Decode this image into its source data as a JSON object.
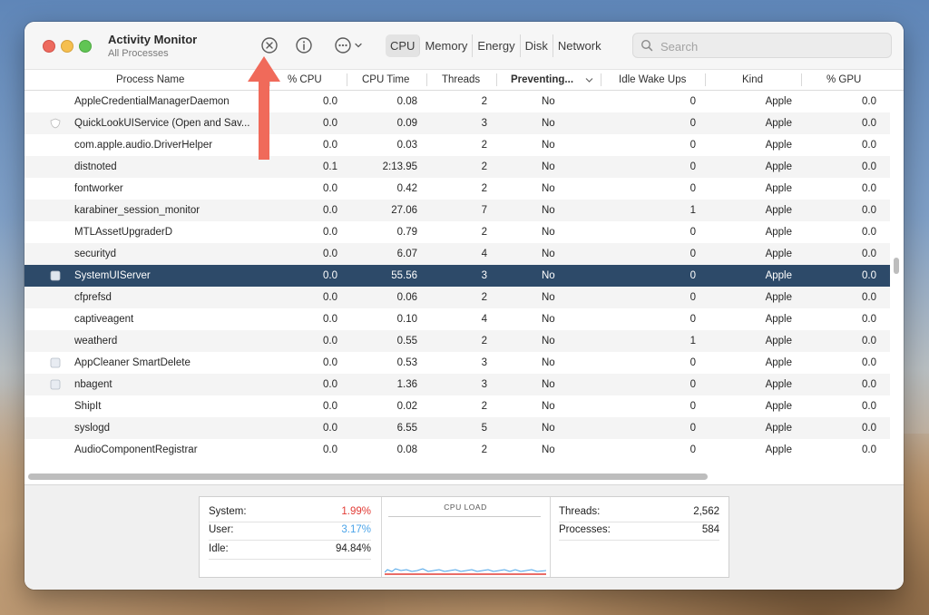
{
  "app": {
    "title": "Activity Monitor",
    "subtitle": "All Processes"
  },
  "toolbar": {
    "stop_icon": "stop-process-icon",
    "info_icon": "info-icon",
    "more_icon": "ellipsis-icon",
    "tabs": [
      "CPU",
      "Memory",
      "Energy",
      "Disk",
      "Network"
    ],
    "active_tab": "CPU",
    "search_placeholder": "Search"
  },
  "columns": [
    "Process Name",
    "% CPU",
    "CPU Time",
    "Threads",
    "Preventing...",
    "Idle Wake Ups",
    "Kind",
    "% GPU"
  ],
  "rows": [
    {
      "icon": "",
      "name": "AppleCredentialManagerDaemon",
      "cpu": "0.0",
      "time": "0.08",
      "threads": "2",
      "preventing": "No",
      "idle": "0",
      "kind": "Apple",
      "gpu": "0.0"
    },
    {
      "icon": "shield",
      "name": "QuickLookUIService (Open and Sav...",
      "cpu": "0.0",
      "time": "0.09",
      "threads": "3",
      "preventing": "No",
      "idle": "0",
      "kind": "Apple",
      "gpu": "0.0"
    },
    {
      "icon": "",
      "name": "com.apple.audio.DriverHelper",
      "cpu": "0.0",
      "time": "0.03",
      "threads": "2",
      "preventing": "No",
      "idle": "0",
      "kind": "Apple",
      "gpu": "0.0"
    },
    {
      "icon": "",
      "name": "distnoted",
      "cpu": "0.1",
      "time": "2:13.95",
      "threads": "2",
      "preventing": "No",
      "idle": "0",
      "kind": "Apple",
      "gpu": "0.0"
    },
    {
      "icon": "",
      "name": "fontworker",
      "cpu": "0.0",
      "time": "0.42",
      "threads": "2",
      "preventing": "No",
      "idle": "0",
      "kind": "Apple",
      "gpu": "0.0"
    },
    {
      "icon": "",
      "name": "karabiner_session_monitor",
      "cpu": "0.0",
      "time": "27.06",
      "threads": "7",
      "preventing": "No",
      "idle": "1",
      "kind": "Apple",
      "gpu": "0.0"
    },
    {
      "icon": "",
      "name": "MTLAssetUpgraderD",
      "cpu": "0.0",
      "time": "0.79",
      "threads": "2",
      "preventing": "No",
      "idle": "0",
      "kind": "Apple",
      "gpu": "0.0"
    },
    {
      "icon": "",
      "name": "securityd",
      "cpu": "0.0",
      "time": "6.07",
      "threads": "4",
      "preventing": "No",
      "idle": "0",
      "kind": "Apple",
      "gpu": "0.0"
    },
    {
      "icon": "app",
      "name": "SystemUIServer",
      "cpu": "0.0",
      "time": "55.56",
      "threads": "3",
      "preventing": "No",
      "idle": "0",
      "kind": "Apple",
      "gpu": "0.0",
      "selected": true
    },
    {
      "icon": "",
      "name": "cfprefsd",
      "cpu": "0.0",
      "time": "0.06",
      "threads": "2",
      "preventing": "No",
      "idle": "0",
      "kind": "Apple",
      "gpu": "0.0"
    },
    {
      "icon": "",
      "name": "captiveagent",
      "cpu": "0.0",
      "time": "0.10",
      "threads": "4",
      "preventing": "No",
      "idle": "0",
      "kind": "Apple",
      "gpu": "0.0"
    },
    {
      "icon": "",
      "name": "weatherd",
      "cpu": "0.0",
      "time": "0.55",
      "threads": "2",
      "preventing": "No",
      "idle": "1",
      "kind": "Apple",
      "gpu": "0.0"
    },
    {
      "icon": "app",
      "name": "AppCleaner SmartDelete",
      "cpu": "0.0",
      "time": "0.53",
      "threads": "3",
      "preventing": "No",
      "idle": "0",
      "kind": "Apple",
      "gpu": "0.0"
    },
    {
      "icon": "app",
      "name": "nbagent",
      "cpu": "0.0",
      "time": "1.36",
      "threads": "3",
      "preventing": "No",
      "idle": "0",
      "kind": "Apple",
      "gpu": "0.0"
    },
    {
      "icon": "",
      "name": "ShipIt",
      "cpu": "0.0",
      "time": "0.02",
      "threads": "2",
      "preventing": "No",
      "idle": "0",
      "kind": "Apple",
      "gpu": "0.0"
    },
    {
      "icon": "",
      "name": "syslogd",
      "cpu": "0.0",
      "time": "6.55",
      "threads": "5",
      "preventing": "No",
      "idle": "0",
      "kind": "Apple",
      "gpu": "0.0"
    },
    {
      "icon": "",
      "name": "AudioComponentRegistrar",
      "cpu": "0.0",
      "time": "0.08",
      "threads": "2",
      "preventing": "No",
      "idle": "0",
      "kind": "Apple",
      "gpu": "0.0"
    }
  ],
  "stats": {
    "system_label": "System:",
    "system_value": "1.99%",
    "user_label": "User:",
    "user_value": "3.17%",
    "idle_label": "Idle:",
    "idle_value": "94.84%",
    "cpu_load_title": "CPU LOAD",
    "threads_label": "Threads:",
    "threads_value": "2,562",
    "processes_label": "Processes:",
    "processes_value": "584"
  },
  "colors": {
    "selected_row": "#2d4a69",
    "system": "#e23b35",
    "user": "#4aa3e8",
    "annotation_arrow": "#f06a5a"
  }
}
